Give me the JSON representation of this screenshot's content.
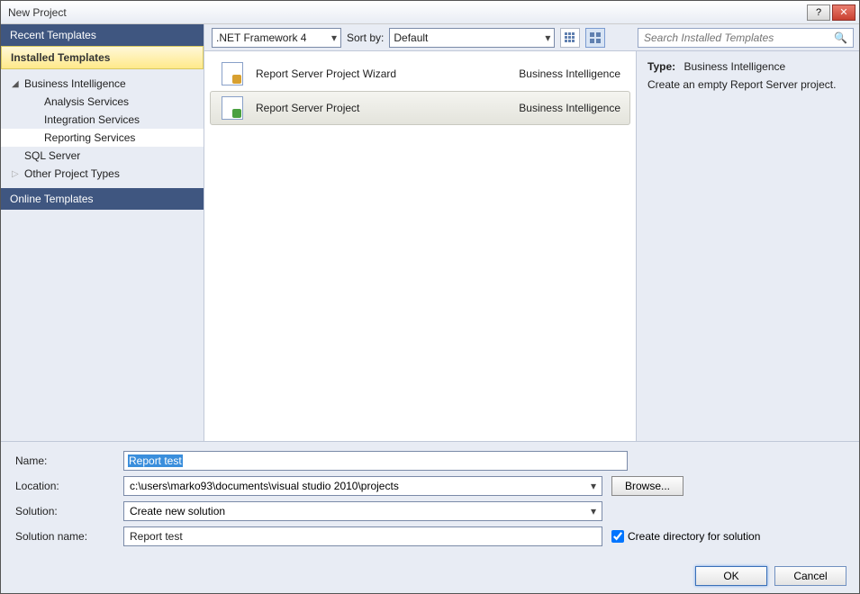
{
  "window": {
    "title": "New Project"
  },
  "toolbar": {
    "framework": ".NET Framework 4",
    "sort_label": "Sort by:",
    "sort_value": "Default",
    "search_placeholder": "Search Installed Templates"
  },
  "sidebar": {
    "recent": "Recent Templates",
    "installed": "Installed Templates",
    "online": "Online Templates",
    "tree": {
      "bi": "Business Intelligence",
      "analysis": "Analysis Services",
      "integration": "Integration Services",
      "reporting": "Reporting Services",
      "sql": "SQL Server",
      "other": "Other Project Types"
    }
  },
  "templates": [
    {
      "name": "Report Server Project Wizard",
      "category": "Business Intelligence",
      "selected": false
    },
    {
      "name": "Report Server Project",
      "category": "Business Intelligence",
      "selected": true
    }
  ],
  "detail": {
    "type_label": "Type:",
    "type_value": "Business Intelligence",
    "description": "Create an empty Report Server project."
  },
  "form": {
    "name_label": "Name:",
    "name_value": "Report test",
    "location_label": "Location:",
    "location_value": "c:\\users\\marko93\\documents\\visual studio 2010\\projects",
    "browse": "Browse...",
    "solution_label": "Solution:",
    "solution_value": "Create new solution",
    "solname_label": "Solution name:",
    "solname_value": "Report test",
    "createdir_label": "Create directory for solution",
    "createdir_checked": true
  },
  "buttons": {
    "ok": "OK",
    "cancel": "Cancel"
  }
}
